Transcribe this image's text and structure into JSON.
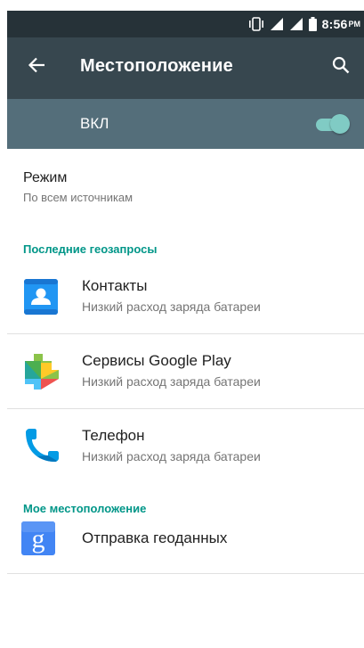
{
  "status_bar": {
    "time": "8:56",
    "ampm": "PM"
  },
  "toolbar": {
    "title": "Местоположение"
  },
  "master_switch": {
    "label": "ВКЛ",
    "state": "on"
  },
  "mode": {
    "title": "Режим",
    "summary": "По всем источникам"
  },
  "recent_requests": {
    "header": "Последние геозапросы",
    "apps": [
      {
        "name": "Контакты",
        "summary": "Низкий расход заряда батареи",
        "icon": "contacts-icon"
      },
      {
        "name": "Сервисы Google Play",
        "summary": "Низкий расход заряда батареи",
        "icon": "google-play-services-icon"
      },
      {
        "name": "Телефон",
        "summary": "Низкий расход заряда батареи",
        "icon": "phone-icon"
      }
    ]
  },
  "my_location": {
    "header": "Мое местоположение",
    "items": [
      {
        "name": "Отправка геоданных",
        "icon": "google-icon"
      }
    ]
  },
  "colors": {
    "status_bar": "#263238",
    "toolbar": "#37474f",
    "switch_bar": "#546e7a",
    "accent": "#009688",
    "switch_on": "#80cbc4"
  }
}
